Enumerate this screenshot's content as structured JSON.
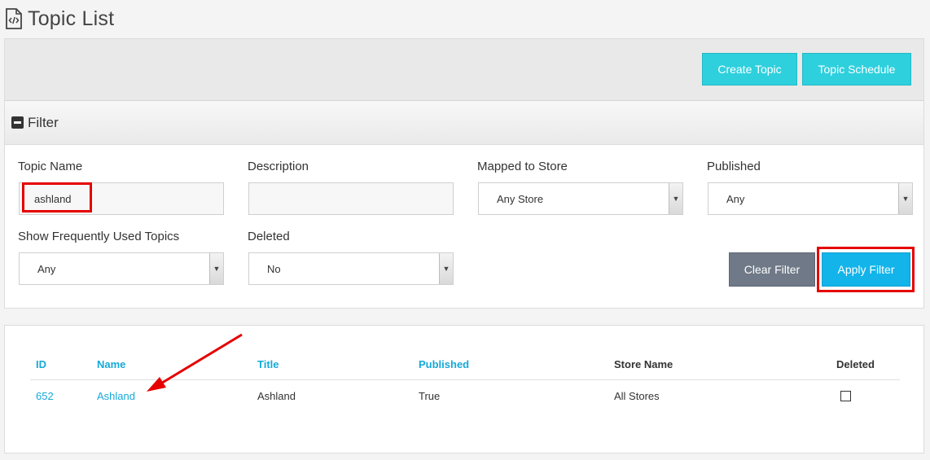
{
  "page": {
    "title": "Topic List",
    "title_icon": "code-document-icon"
  },
  "toolbar": {
    "create_label": "Create Topic",
    "schedule_label": "Topic Schedule"
  },
  "filter": {
    "header": "Filter",
    "header_icon": "minus-square-icon",
    "fields": {
      "topic_name": {
        "label": "Topic Name",
        "value": "ashland"
      },
      "description": {
        "label": "Description",
        "value": ""
      },
      "mapped_store": {
        "label": "Mapped to Store",
        "value": "Any Store"
      },
      "published": {
        "label": "Published",
        "value": "Any"
      },
      "frequent": {
        "label": "Show Frequently Used Topics",
        "value": "Any"
      },
      "deleted": {
        "label": "Deleted",
        "value": "No"
      }
    },
    "clear_label": "Clear Filter",
    "apply_label": "Apply Filter"
  },
  "table": {
    "columns": [
      "ID",
      "Name",
      "Title",
      "Published",
      "Store Name",
      "Deleted"
    ],
    "rows": [
      {
        "id": "652",
        "name": "Ashland",
        "title": "Ashland",
        "published": "True",
        "store": "All Stores",
        "deleted": false
      }
    ]
  },
  "colors": {
    "teal_button": "#2ed0dd",
    "apply_button": "#12b4ea",
    "clear_button": "#6f7987",
    "link": "#16a9d8",
    "highlight": "#e60000"
  }
}
